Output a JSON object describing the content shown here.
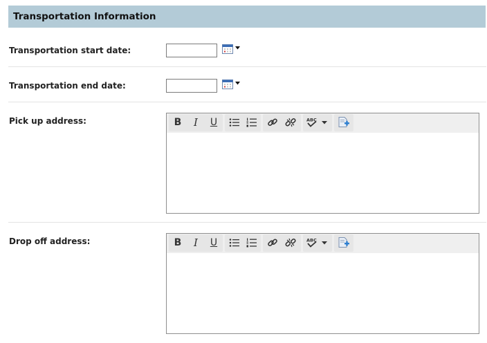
{
  "section": {
    "title": "Transportation Information"
  },
  "fields": {
    "start_date": {
      "label": "Transportation start date:",
      "value": ""
    },
    "end_date": {
      "label": "Transportation end date:",
      "value": ""
    },
    "pickup": {
      "label": "Pick up address:",
      "content": ""
    },
    "dropoff": {
      "label": "Drop off address:",
      "content": ""
    }
  },
  "toolbar": {
    "bold": "B",
    "italic": "I",
    "underline": "U",
    "buttons": [
      "bold",
      "italic",
      "underline",
      "bulleted-list",
      "numbered-list",
      "link",
      "unlink",
      "spell-check",
      "spell-check-dropdown",
      "insert-template"
    ]
  },
  "icons": {
    "calendar": "calendar-icon",
    "dropdown": "caret-down-icon"
  },
  "colors": {
    "header_bg": "#b3cbd7",
    "calendar_accent": "#3b6db5",
    "calendar_mark": "#d33b3b"
  }
}
